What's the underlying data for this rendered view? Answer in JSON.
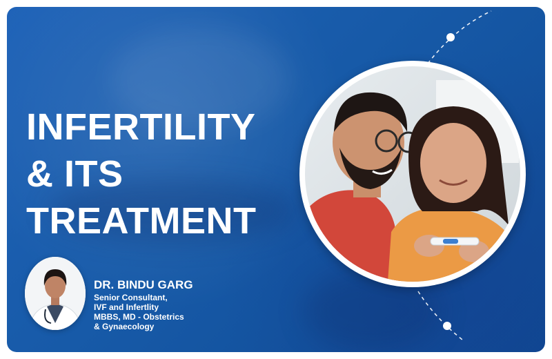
{
  "banner": {
    "title_lines": [
      "INFERTILITY",
      "& ITS",
      "TREATMENT"
    ],
    "photo_icon": "couple-with-pregnancy-test-photo",
    "colors": {
      "background": "#1a5fb0",
      "text": "#ffffff"
    }
  },
  "doctor": {
    "name": "DR. BINDU GARG",
    "credentials": [
      "Senior Consultant,",
      "IVF and Infertlity",
      "MBBS, MD - Obstetrics",
      "& Gynaecology"
    ],
    "photo_icon": "doctor-portrait-photo"
  }
}
